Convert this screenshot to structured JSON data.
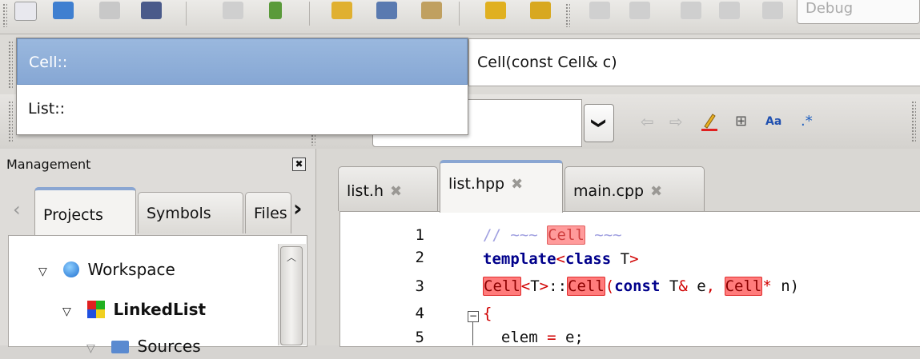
{
  "toolbar": {
    "build_config": "Debug"
  },
  "scope": {
    "options": [
      "Cell::",
      "List::"
    ],
    "selected": "Cell::",
    "function": "Cell(const Cell& c)"
  },
  "search": {
    "value": "",
    "dropdown_glyph": "❯"
  },
  "management": {
    "title": "Management",
    "close_glyph": "✖",
    "tabs": [
      "Projects",
      "Symbols",
      "Files"
    ],
    "active_tab": "Projects",
    "tree": [
      {
        "label": "Workspace",
        "icon": "workspace-globe-icon",
        "bold": false
      },
      {
        "label": "LinkedList",
        "icon": "project-colorful-icon",
        "bold": true
      },
      {
        "label": "Sources",
        "icon": "folder-icon",
        "bold": false
      }
    ]
  },
  "editor": {
    "tabs": [
      {
        "label": "list.h"
      },
      {
        "label": "list.hpp",
        "active": true
      },
      {
        "label": "main.cpp"
      }
    ],
    "line_numbers": [
      "1",
      "2",
      "3",
      "4",
      "5"
    ],
    "code": {
      "l1_prefix": "// ~~~ ",
      "l1_word": "Cell",
      "l1_suffix": " ~~~",
      "l2_kw1": "template",
      "l2_lt": "<",
      "l2_kw2": "class",
      "l2_rest": " T",
      "l2_gt": ">",
      "l3_cell1": "Cell",
      "l3_lt": "<",
      "l3_T": "T",
      "l3_gt": ">",
      "l3_sep": "::",
      "l3_cell2": "Cell",
      "l3_paren": "(",
      "l3_kw": "const",
      "l3_t2": " T",
      "l3_amp": "&",
      "l3_e": " e",
      "l3_comma": ",",
      "l3_sp": " ",
      "l3_cell3": "Cell",
      "l3_star": "*",
      "l3_n": " n)",
      "l4_brace": "{",
      "l5_a": "  elem ",
      "l5_eq": "=",
      "l5_b": " e;"
    }
  },
  "colors": {
    "accent_blue": "#8aa6d2",
    "highlight_red": "#ff7b7b",
    "keyword": "#00008b"
  }
}
